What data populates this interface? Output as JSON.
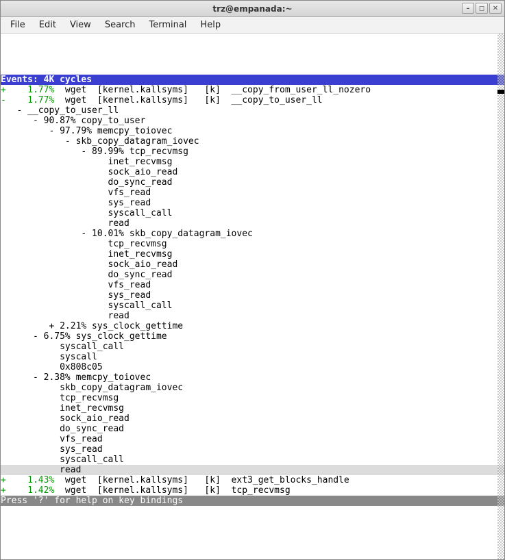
{
  "window": {
    "title": "trz@empanada:~"
  },
  "menu": {
    "file": "File",
    "edit": "Edit",
    "view": "View",
    "search": "Search",
    "terminal": "Terminal",
    "help": "Help"
  },
  "header": "Events: 4K cycles",
  "rows": [
    {
      "sign": "+",
      "pct": "1.77%",
      "bin": "wget",
      "mod": "[kernel.kallsyms]",
      "tag": "[k]",
      "sym": "__copy_from_user_ll_nozero"
    },
    {
      "sign": "-",
      "pct": "1.77%",
      "bin": "wget",
      "mod": "[kernel.kallsyms]",
      "tag": "[k]",
      "sym": "__copy_to_user_ll"
    }
  ],
  "tree": [
    "   - __copy_to_user_ll",
    "      - 90.87% copy_to_user",
    "         - 97.79% memcpy_toiovec",
    "            - skb_copy_datagram_iovec",
    "               - 89.99% tcp_recvmsg",
    "                    inet_recvmsg",
    "                    sock_aio_read",
    "                    do_sync_read",
    "                    vfs_read",
    "                    sys_read",
    "                    syscall_call",
    "                    read",
    "               - 10.01% skb_copy_datagram_iovec",
    "                    tcp_recvmsg",
    "                    inet_recvmsg",
    "                    sock_aio_read",
    "                    do_sync_read",
    "                    vfs_read",
    "                    sys_read",
    "                    syscall_call",
    "                    read",
    "         + 2.21% sys_clock_gettime",
    "      - 6.75% sys_clock_gettime",
    "           syscall_call",
    "           syscall",
    "           0x808c05",
    "      - 2.38% memcpy_toiovec",
    "           skb_copy_datagram_iovec",
    "           tcp_recvmsg",
    "           inet_recvmsg",
    "           sock_aio_read",
    "           do_sync_read",
    "           vfs_read",
    "           sys_read",
    "           syscall_call"
  ],
  "highlighted_line": "           read",
  "bottom_rows": [
    {
      "sign": "+",
      "pct": "1.43%",
      "bin": "wget",
      "mod": "[kernel.kallsyms]",
      "tag": "[k]",
      "sym": "ext3_get_blocks_handle"
    },
    {
      "sign": "+",
      "pct": "1.42%",
      "bin": "wget",
      "mod": "[kernel.kallsyms]",
      "tag": "[k]",
      "sym": "tcp_recvmsg"
    }
  ],
  "footer": "Press '?' for help on key bindings"
}
